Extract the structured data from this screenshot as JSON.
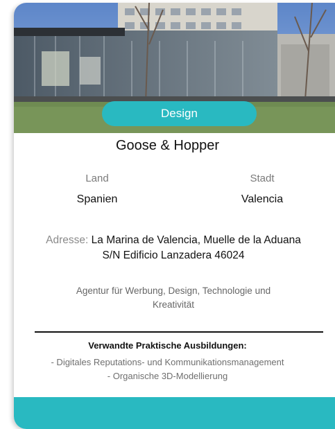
{
  "card": {
    "category_badge": "Design",
    "title": "Goose & Hopper",
    "country_label": "Land",
    "country_value": "Spanien",
    "city_label": "Stadt",
    "city_value": "Valencia",
    "address_label": "Adresse:",
    "address_value": "La Marina de Valencia, Muelle de la Aduana S/N Edificio Lanzadera 46024",
    "description": "Agentur für Werbung, Design, Technologie und Kreativität",
    "related_title": "Verwandte Praktische Ausbildungen:",
    "related_items": [
      "- Digitales Reputations- und Kommunikationsmanagement",
      "- Organische 3D-Modellierung"
    ]
  },
  "colors": {
    "accent": "#29b9c1",
    "text": "#111111",
    "muted": "#7a7a7a"
  }
}
